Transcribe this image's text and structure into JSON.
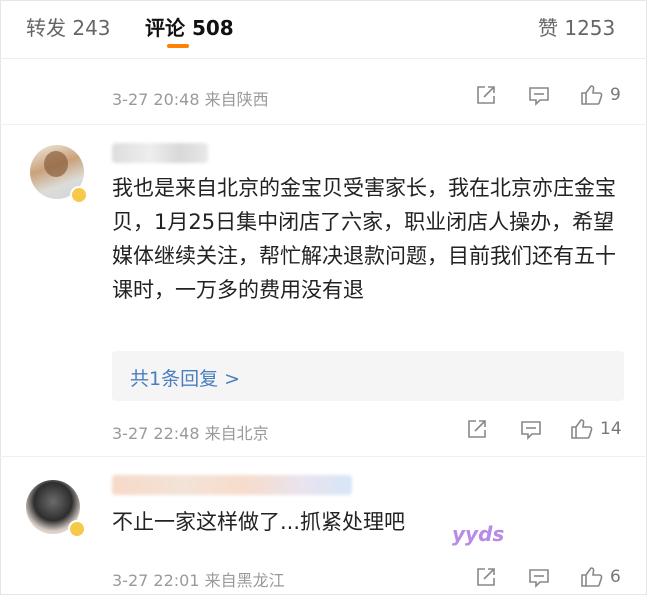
{
  "tabs": {
    "repost": "转发 243",
    "comment": "评论 508",
    "like": "赞 1253"
  },
  "prev_comment": {
    "meta": "3-27 20:48 来自陕西",
    "likes": "9"
  },
  "comment1": {
    "text": "我也是来自北京的金宝贝受害家长，我在北京亦庄金宝贝，1月25日集中闭店了六家，职业闭店人操办，希望媒体继续关注，帮忙解决退款问题，目前我们还有五十课时，一万多的费用没有退",
    "reply_link": "共1条回复 >",
    "meta": "3-27 22:48 来自北京",
    "likes": "14"
  },
  "comment2": {
    "text": "不止一家这样做了...抓紧处理吧",
    "sticker": "yyds",
    "meta": "3-27 22:01 来自黑龙江",
    "likes": "6"
  },
  "icons": [
    "share-icon",
    "comment-icon",
    "like-icon",
    "verified-badge-icon"
  ],
  "colors": {
    "accent": "#ff8200",
    "link": "#4a7ebf",
    "badge": "#f7c948"
  }
}
